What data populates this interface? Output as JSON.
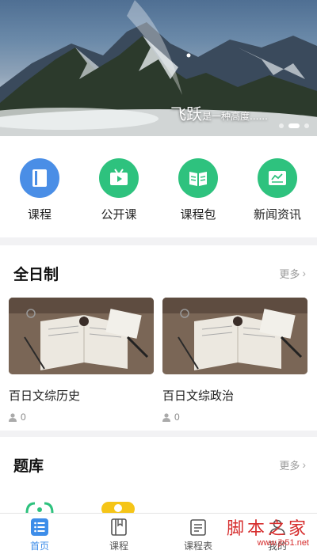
{
  "banner": {
    "caption_big": "飞跃",
    "caption_small": "是一种高度......",
    "dots": 3,
    "active_dot": 2
  },
  "nav": {
    "items": [
      {
        "label": "课程",
        "icon": "book-icon",
        "color": "#4a8ee6"
      },
      {
        "label": "公开课",
        "icon": "video-tv-icon",
        "color": "#2ec27e"
      },
      {
        "label": "课程包",
        "icon": "open-book-icon",
        "color": "#2ec27e"
      },
      {
        "label": "新闻资讯",
        "icon": "news-icon",
        "color": "#2ec27e"
      }
    ]
  },
  "fulltime": {
    "title": "全日制",
    "more": "更多",
    "courses": [
      {
        "title": "百日文综历史",
        "count": "0"
      },
      {
        "title": "百日文综政治",
        "count": "0"
      }
    ]
  },
  "question_bank": {
    "title": "题库",
    "more": "更多"
  },
  "tabbar": {
    "items": [
      {
        "label": "首页",
        "icon": "home-list-icon",
        "active": true
      },
      {
        "label": "课程",
        "icon": "book-icon",
        "active": false
      },
      {
        "label": "课程表",
        "icon": "schedule-icon",
        "active": false
      },
      {
        "label": "我的",
        "icon": "user-icon",
        "active": false
      }
    ]
  },
  "watermark": {
    "big": "脚本之家",
    "small": "www.jb51.net"
  },
  "colors": {
    "accent_blue": "#3d8de9",
    "accent_green": "#2ec27e"
  }
}
